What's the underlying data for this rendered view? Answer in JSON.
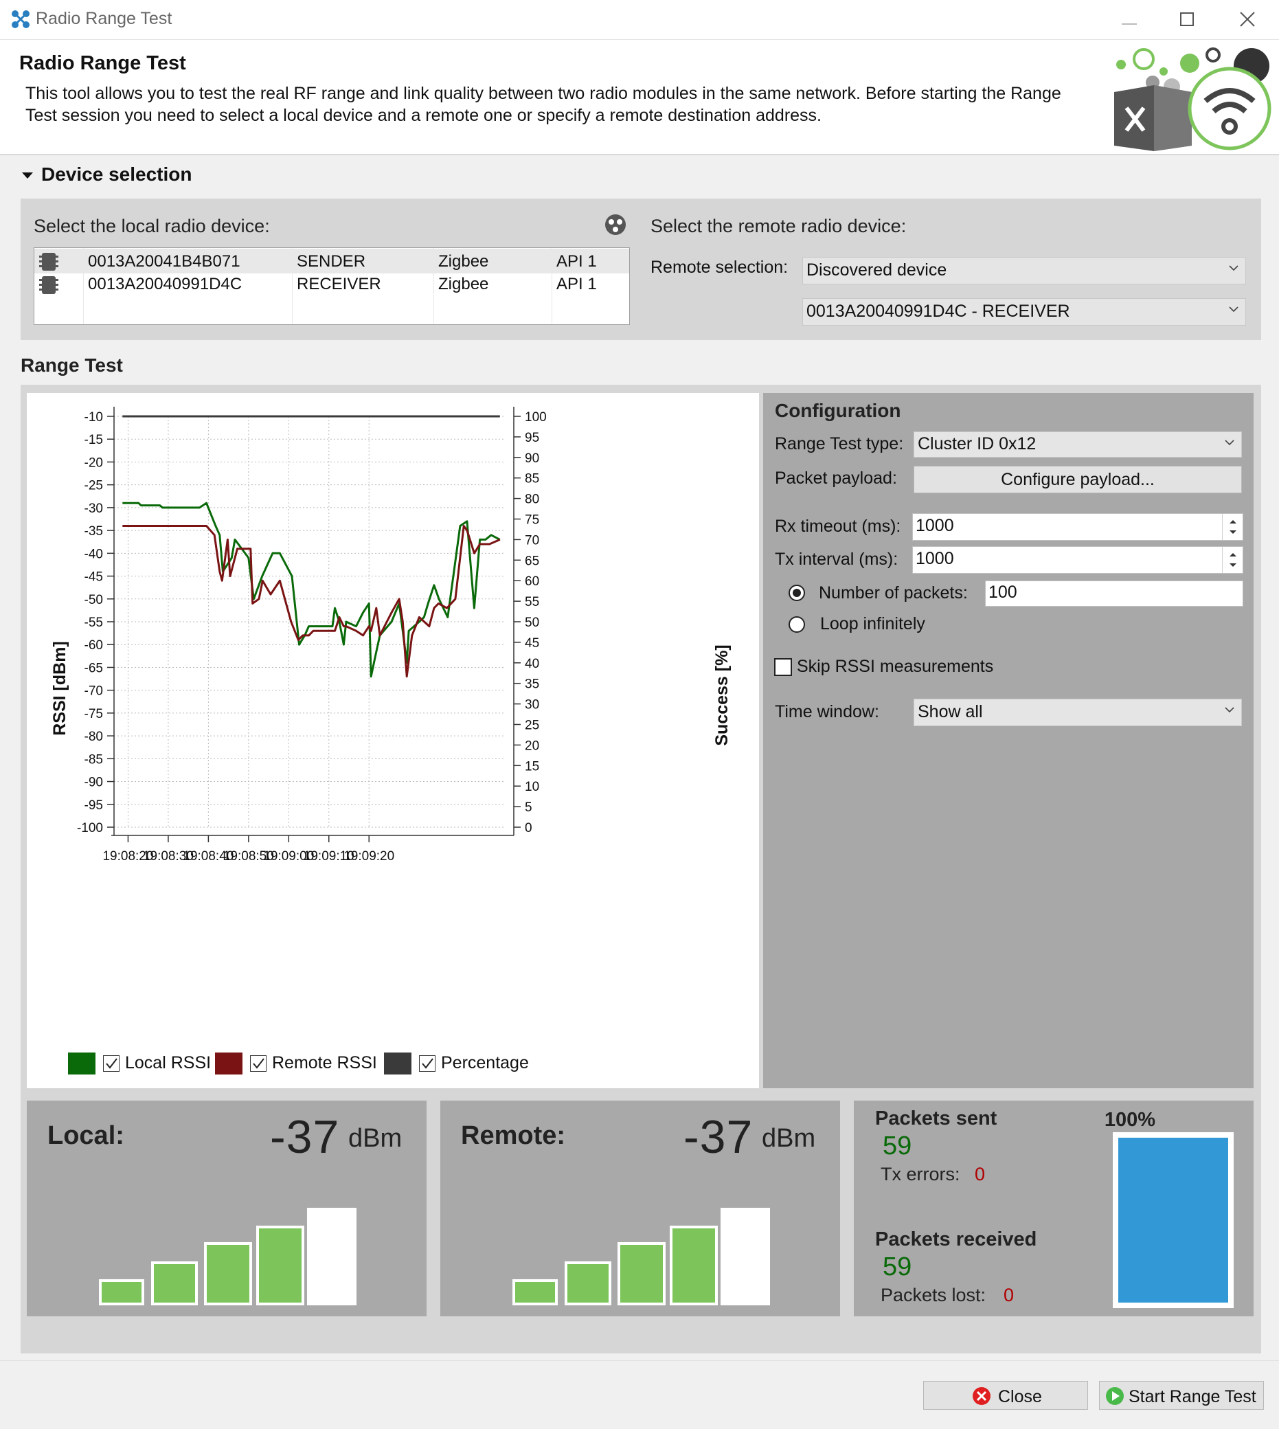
{
  "window": {
    "title": "Radio Range Test"
  },
  "header": {
    "title": "Radio Range Test",
    "description": "This tool allows you to test the real RF range and link quality between two radio modules in the same network. Before starting the Range Test session you need to select a local device and a remote one or specify a remote destination address."
  },
  "device_selection": {
    "title": "Device selection",
    "local_label": "Select the local radio device:",
    "remote_label": "Select the remote radio device:",
    "devices": [
      {
        "address": "0013A20041B4B071",
        "role": "SENDER",
        "protocol": "Zigbee",
        "mode": "API 1"
      },
      {
        "address": "0013A20040991D4C",
        "role": "RECEIVER",
        "protocol": "Zigbee",
        "mode": "API 1"
      }
    ],
    "remote_selection_label": "Remote selection:",
    "remote_selection_value": "Discovered device",
    "remote_device_value": "0013A20040991D4C - RECEIVER"
  },
  "range_test": {
    "title": "Range Test"
  },
  "configuration": {
    "title": "Configuration",
    "type_label": "Range Test type:",
    "type_value": "Cluster ID 0x12",
    "payload_label": "Packet payload:",
    "payload_button": "Configure payload...",
    "rx_timeout_label": "Rx timeout (ms):",
    "rx_timeout_value": "1000",
    "tx_interval_label": "Tx interval (ms):",
    "tx_interval_value": "1000",
    "num_packets_label": "Number of packets:",
    "num_packets_value": "100",
    "loop_label": "Loop infinitely",
    "skip_rssi_label": "Skip RSSI measurements",
    "time_window_label": "Time window:",
    "time_window_value": "Show all"
  },
  "colors": {
    "local": "#0a6a0a",
    "remote": "#7a1414",
    "percentage": "#3a3a3a",
    "meter_bar": "#7dc55b",
    "progress": "#3399d6"
  },
  "chart_data": {
    "type": "line",
    "ylabel": "RSSI [dBm]",
    "y2label": "Success [%]",
    "ylim": [
      -100,
      -10
    ],
    "y2lim": [
      0,
      100
    ],
    "y_ticks": [
      "-10",
      "-15",
      "-20",
      "-25",
      "-30",
      "-35",
      "-40",
      "-45",
      "-50",
      "-55",
      "-60",
      "-65",
      "-70",
      "-75",
      "-80",
      "-85",
      "-90",
      "-95",
      "-100"
    ],
    "y2_ticks": [
      "100",
      "95",
      "90",
      "85",
      "80",
      "75",
      "70",
      "65",
      "60",
      "55",
      "50",
      "45",
      "40",
      "35",
      "30",
      "25",
      "20",
      "15",
      "10",
      "5",
      "0"
    ],
    "x_ticks": [
      "19:08:20",
      "19:08:30",
      "19:08:40",
      "19:08:50",
      "19:09:00",
      "19:09:10",
      "19:09:20"
    ],
    "grid": true,
    "legend_position": "bottom",
    "series": [
      {
        "name": "Local RSSI",
        "color": "#0a6a0a",
        "x": [
          18.6,
          20.5,
          21.2,
          22.6,
          23.2,
          27.9,
          28.6,
          30.4,
          31.6,
          32.4,
          33.8,
          35.3,
          36.7,
          37.8,
          39.5,
          41.8,
          42.8,
          43.6,
          45.8,
          46.6,
          50.0,
          51.3,
          53.4,
          56.0,
          57.8,
          60.8,
          62.6,
          64.0,
          65.0,
          66.1,
          66.7,
          69.1,
          70.9,
          71.5,
          72.6,
          73.7,
          74.3,
          76.8,
          78.5,
          80.0,
          80.5,
          81.7,
          82.7,
          85.6,
          87.5,
          88.1,
          89.4,
          89.9,
          92.5,
          93.7,
          94.7,
          96.2,
          97.4,
          99.6,
          102.7,
          104.4,
          106.2,
          107.6,
          109.0,
          110.4,
          112.6
        ],
        "y": [
          -29,
          -29,
          -29,
          -29,
          -29.5,
          -29.5,
          -30,
          -30,
          -30,
          -30,
          -30,
          -30,
          -30,
          -30,
          -29,
          -34,
          -36,
          -44,
          -41,
          -37,
          -41,
          -50,
          -45,
          -40,
          -40,
          -45,
          -60,
          -58,
          -56,
          -56,
          -56,
          -56,
          -56,
          -52,
          -55,
          -60,
          -55,
          -56,
          -53,
          -51,
          -67,
          -62,
          -58,
          -55,
          -51,
          -55,
          -64,
          -57,
          -55,
          -54,
          -51,
          -47,
          -50,
          -54,
          -34,
          -33,
          -52,
          -37,
          -37,
          -36,
          -37
        ],
        "time_span": [
          19.08,
          19.09
        ]
      },
      {
        "name": "Remote RSSI",
        "color": "#7a1414",
        "x": [
          18.6,
          20.5,
          22.0,
          24.0,
          26.0,
          28.0,
          29.6,
          30.4,
          31.6,
          32.4,
          33.8,
          35.3,
          36.7,
          37.8,
          39.5,
          41.5,
          42.8,
          43.4,
          44.8,
          45.4,
          47.2,
          50.5,
          51.0,
          52.6,
          53.5,
          55.5,
          57.8,
          60.6,
          62.4,
          63.5,
          65.0,
          66.1,
          67.0,
          69.1,
          71.5,
          72.6,
          73.7,
          74.3,
          76.8,
          78.5,
          80.0,
          80.5,
          81.8,
          82.7,
          85.6,
          87.5,
          88.4,
          89.4,
          90.7,
          92.5,
          95.0,
          96.2,
          97.3,
          99.4,
          101.5,
          103.6,
          104.4,
          105.5,
          106.2,
          107.6,
          110.0,
          112.6
        ],
        "y": [
          -34,
          -34,
          -34,
          -34,
          -34,
          -34,
          -34,
          -34,
          -34,
          -34,
          -34,
          -34,
          -34,
          -34,
          -34,
          -36,
          -44,
          -46,
          -37,
          -45,
          -39,
          -39,
          -51,
          -50,
          -46,
          -49,
          -46,
          -55,
          -59,
          -58,
          -58,
          -57,
          -57,
          -57,
          -57,
          -54,
          -56,
          -56,
          -57,
          -58,
          -56,
          -57,
          -52,
          -58,
          -53,
          -50,
          -55,
          -67,
          -58,
          -54,
          -56,
          -52,
          -51,
          -52,
          -50,
          -34,
          -35,
          -38,
          -40,
          -38,
          -38,
          -37
        ],
        "time_span": [
          19.08,
          19.09
        ]
      },
      {
        "name": "Percentage",
        "color": "#3a3a3a",
        "y2": 100
      }
    ]
  },
  "local_meter": {
    "label": "Local:",
    "value": "-37",
    "unit": "dBm",
    "level": 4,
    "of": 5
  },
  "remote_meter": {
    "label": "Remote:",
    "value": "-37",
    "unit": "dBm",
    "level": 4,
    "of": 5
  },
  "stats": {
    "packets_sent_label": "Packets sent",
    "packets_sent": "59",
    "tx_errors_label": "Tx errors:",
    "tx_errors": "0",
    "packets_received_label": "Packets received",
    "packets_received": "59",
    "packets_lost_label": "Packets lost:",
    "packets_lost": "0",
    "percent": "100%",
    "percent_fraction": 1.0
  },
  "buttons": {
    "close": "Close",
    "start": "Start Range Test"
  }
}
